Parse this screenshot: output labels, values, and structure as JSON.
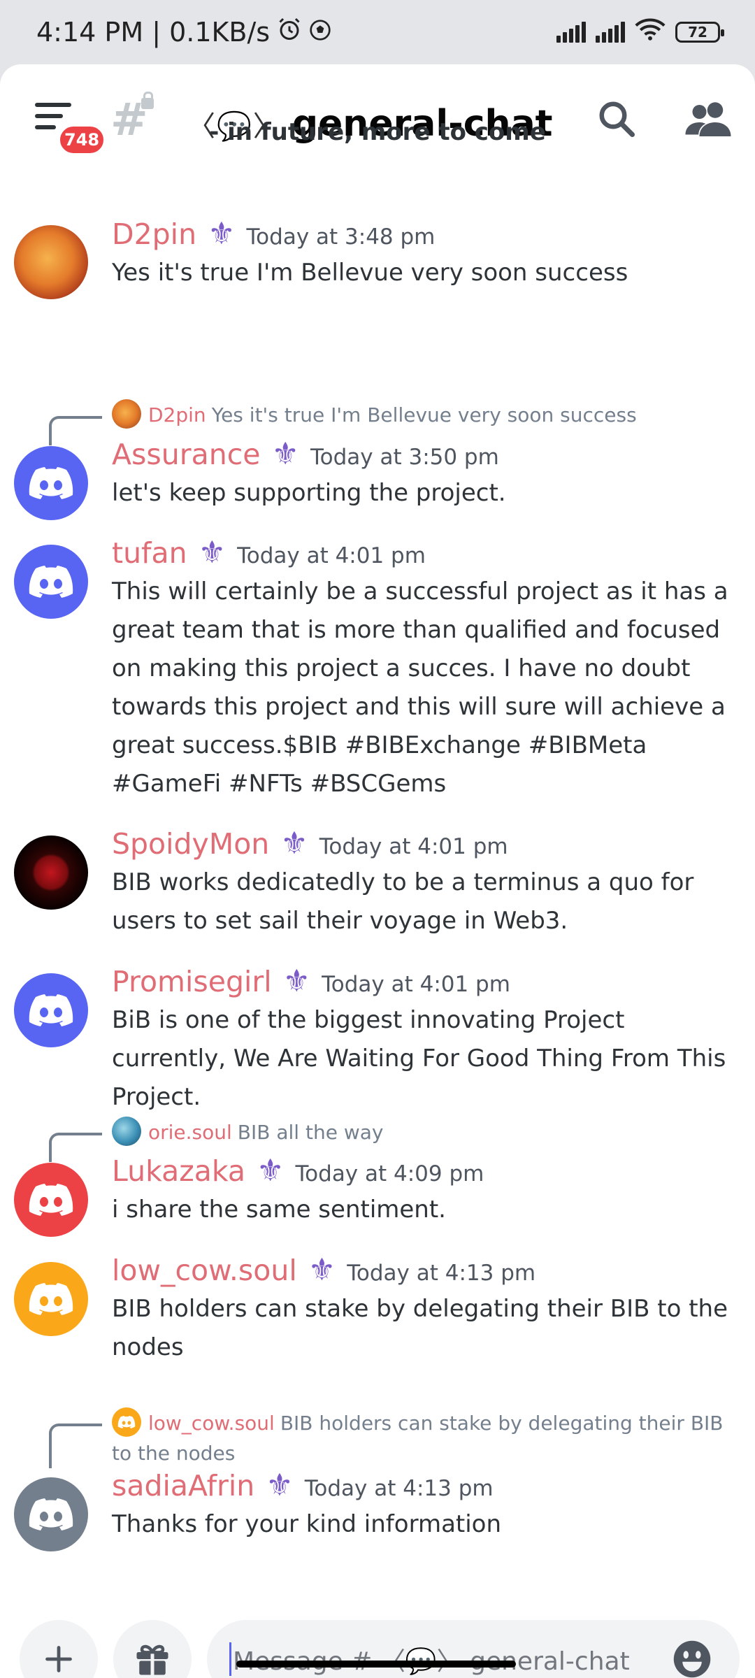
{
  "status_bar": {
    "time_and_speed": "4:14 PM | 0.1KB/s",
    "battery": "72"
  },
  "header": {
    "menu_badge": "748",
    "channel_emoji": "〈💬〉",
    "channel_name": "general-chat"
  },
  "chat": {
    "top_note": "- in future, more to come",
    "messages": [
      {
        "author": "D2pin",
        "time": "Today at 3:48 pm",
        "text": "Yes it's true I'm Bellevue very soon success"
      },
      {
        "reply_author": "D2pin",
        "reply_text": "Yes it's true I'm Bellevue very soon success",
        "author": "Assurance",
        "time": "Today at 3:50 pm",
        "text": "let's keep supporting the project."
      },
      {
        "author": "tufan",
        "time": "Today at 4:01 pm",
        "text": "This will certainly be a successful project as it has a great team that is more than qualified and focused on making this project a succes. I have no doubt towards this project and this will sure will achieve a great success.$BIB #BIBExchange #BIBMeta #GameFi #NFTs #BSCGems"
      },
      {
        "author": "SpoidyMon",
        "time": "Today at 4:01 pm",
        "text": "BIB works dedicatedly to be a terminus a quo for users to set sail their voyage in Web3."
      },
      {
        "author": "Promisegirl",
        "time": "Today at 4:01 pm",
        "text": "BiB is one of the biggest innovating Project currently, We Are Waiting For Good Thing From This Project."
      },
      {
        "reply_author": "orie.soul",
        "reply_text": "BIB all the way",
        "author": "Lukazaka",
        "time": "Today at 4:09 pm",
        "text": "i share the same sentiment."
      },
      {
        "author": "low_cow.soul",
        "time": "Today at 4:13 pm",
        "text": "BIB holders can stake by delegating their BIB to the nodes"
      },
      {
        "reply_author": "low_cow.soul",
        "reply_text": "BIB holders can stake by delegating their BIB to the nodes",
        "author": "sadiaAfrin",
        "time": "Today at 4:13 pm",
        "text": "Thanks for your kind information"
      }
    ],
    "role_icon": "⚜"
  },
  "composer": {
    "placeholder": "Message # 〈💬〉 general-chat"
  },
  "colors": {
    "username": "#e06c75",
    "blurple": "#5865f2",
    "role_icon": "#7a5bc7"
  }
}
